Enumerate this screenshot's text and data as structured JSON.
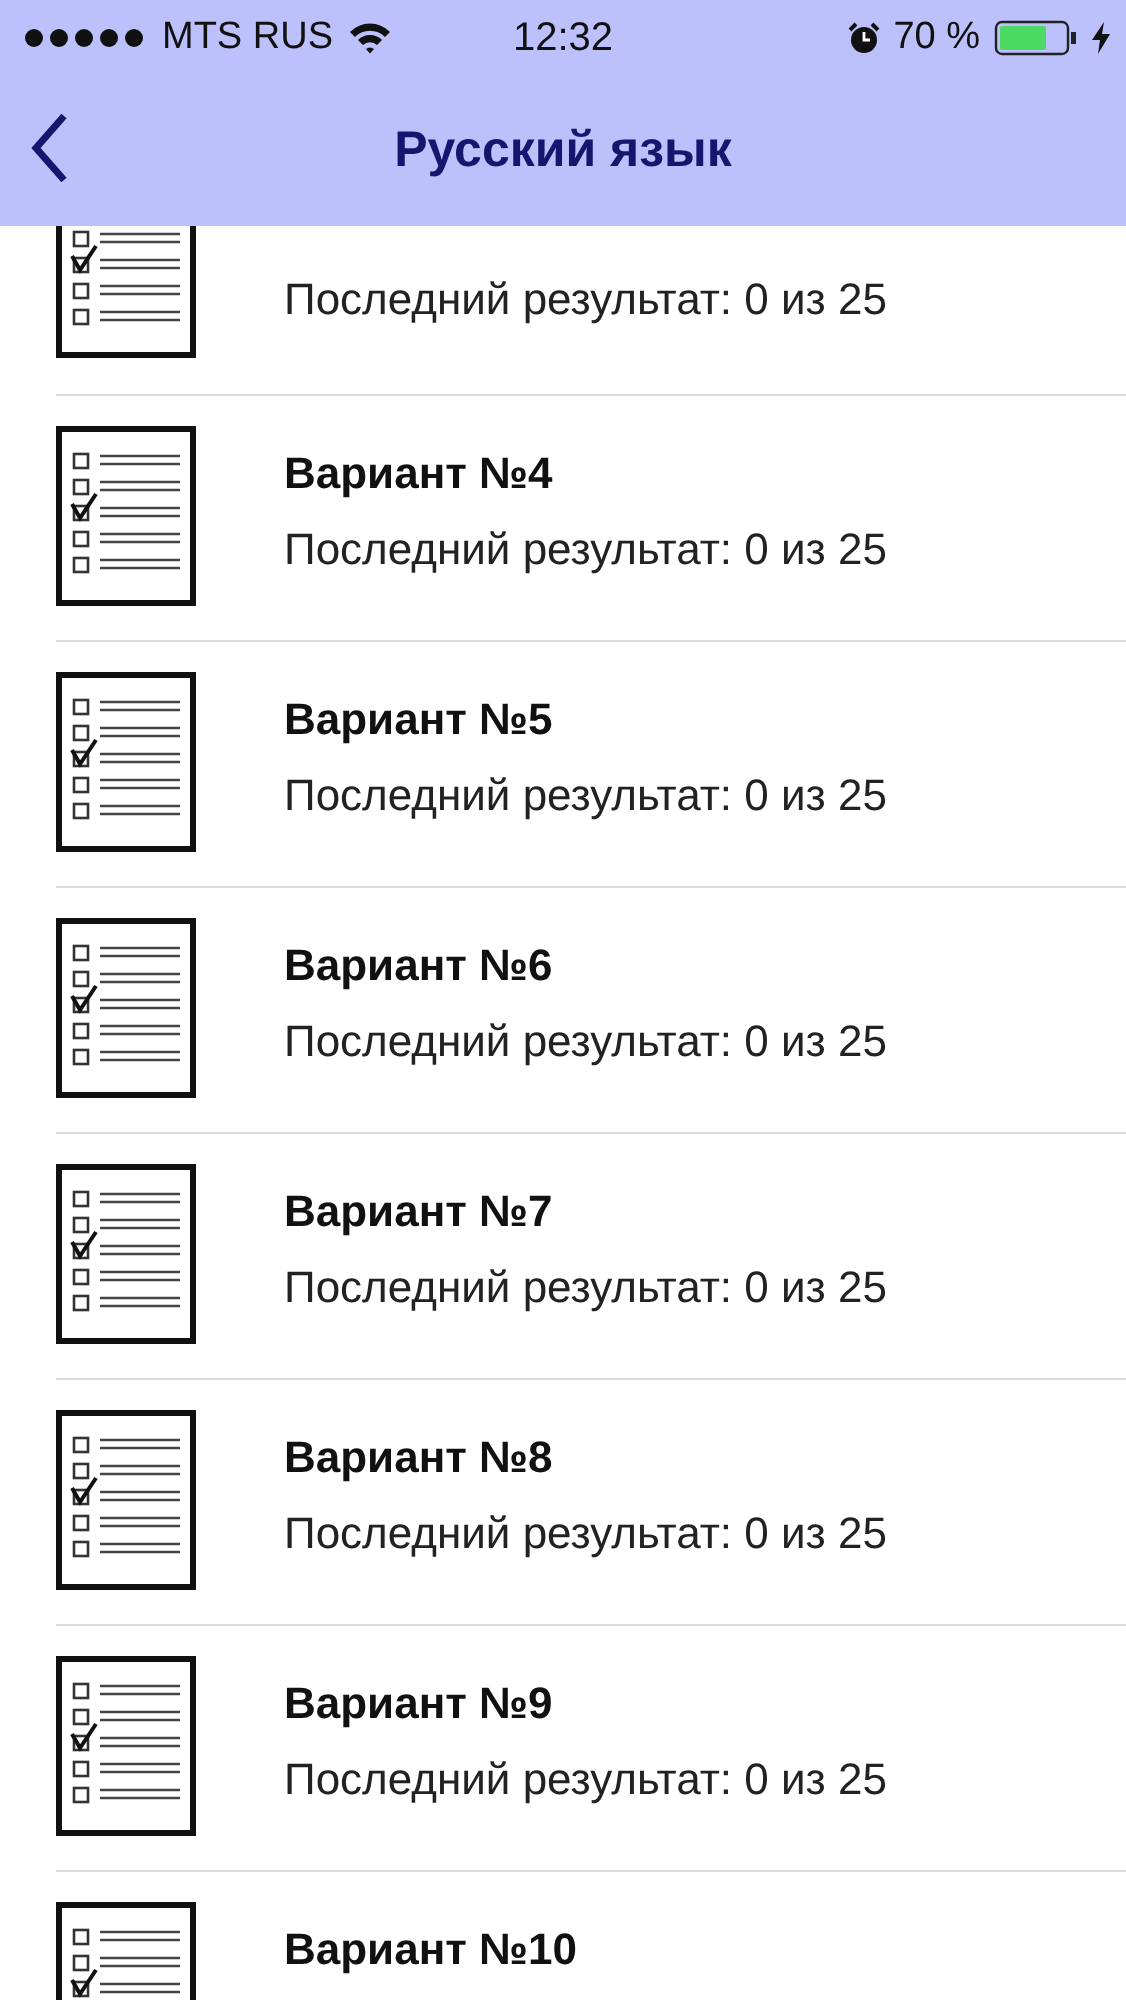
{
  "status_bar": {
    "carrier": "MTS RUS",
    "time": "12:32",
    "battery": "70 %"
  },
  "nav": {
    "title": "Русский язык"
  },
  "variants": [
    {
      "result": "Последний результат: 0 из 25"
    },
    {
      "title": "Вариант №4",
      "result": "Последний результат: 0 из 25"
    },
    {
      "title": "Вариант №5",
      "result": "Последний результат: 0 из 25"
    },
    {
      "title": "Вариант №6",
      "result": "Последний результат: 0 из 25"
    },
    {
      "title": "Вариант №7",
      "result": "Последний результат: 0 из 25"
    },
    {
      "title": "Вариант №8",
      "result": "Последний результат: 0 из 25"
    },
    {
      "title": "Вариант №9",
      "result": "Последний результат: 0 из 25"
    },
    {
      "title": "Вариант №10"
    }
  ]
}
